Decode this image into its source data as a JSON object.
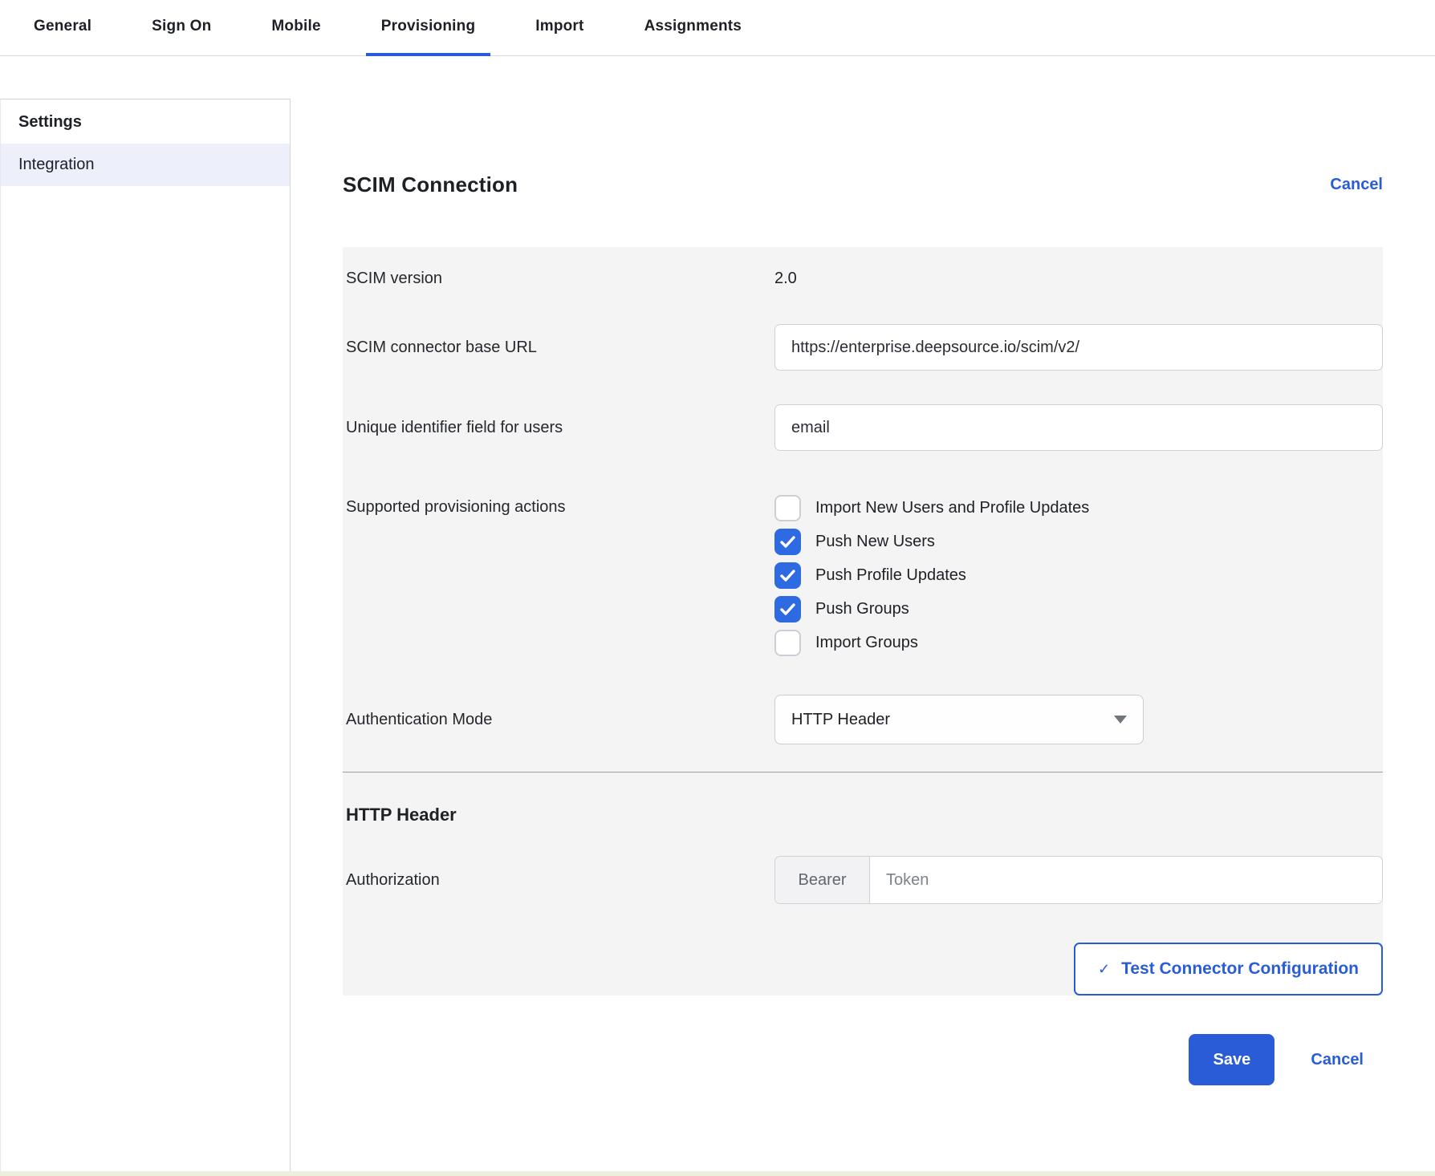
{
  "tabs": {
    "items": [
      {
        "label": "General",
        "active": false
      },
      {
        "label": "Sign On",
        "active": false
      },
      {
        "label": "Mobile",
        "active": false
      },
      {
        "label": "Provisioning",
        "active": true
      },
      {
        "label": "Import",
        "active": false
      },
      {
        "label": "Assignments",
        "active": false
      }
    ]
  },
  "sidebar": {
    "header": "Settings",
    "items": [
      {
        "label": "Integration",
        "active": true
      }
    ]
  },
  "main": {
    "title": "SCIM Connection",
    "cancel_link": "Cancel",
    "form": {
      "scim_version": {
        "label": "SCIM version",
        "value": "2.0"
      },
      "base_url": {
        "label": "SCIM connector base URL",
        "value": "https://enterprise.deepsource.io/scim/v2/"
      },
      "unique_id": {
        "label": "Unique identifier field for users",
        "value": "email"
      },
      "provisioning_actions": {
        "label": "Supported provisioning actions",
        "options": [
          {
            "label": "Import New Users and Profile Updates",
            "checked": false
          },
          {
            "label": "Push New Users",
            "checked": true
          },
          {
            "label": "Push Profile Updates",
            "checked": true
          },
          {
            "label": "Push Groups",
            "checked": true
          },
          {
            "label": "Import Groups",
            "checked": false
          }
        ]
      },
      "auth_mode": {
        "label": "Authentication Mode",
        "value": "HTTP Header"
      },
      "http_header_section": {
        "title": "HTTP Header"
      },
      "authorization": {
        "label": "Authorization",
        "prefix": "Bearer",
        "placeholder": "Token",
        "value": ""
      }
    },
    "test_button": {
      "label": "Test Connector Configuration",
      "check_glyph": "✓"
    },
    "footer": {
      "save": "Save",
      "cancel": "Cancel"
    }
  },
  "colors": {
    "accent": "#2a5cd8",
    "checkbox": "#2e6be2",
    "panel": "#f4f4f5",
    "sideActive": "#edf0fa"
  }
}
